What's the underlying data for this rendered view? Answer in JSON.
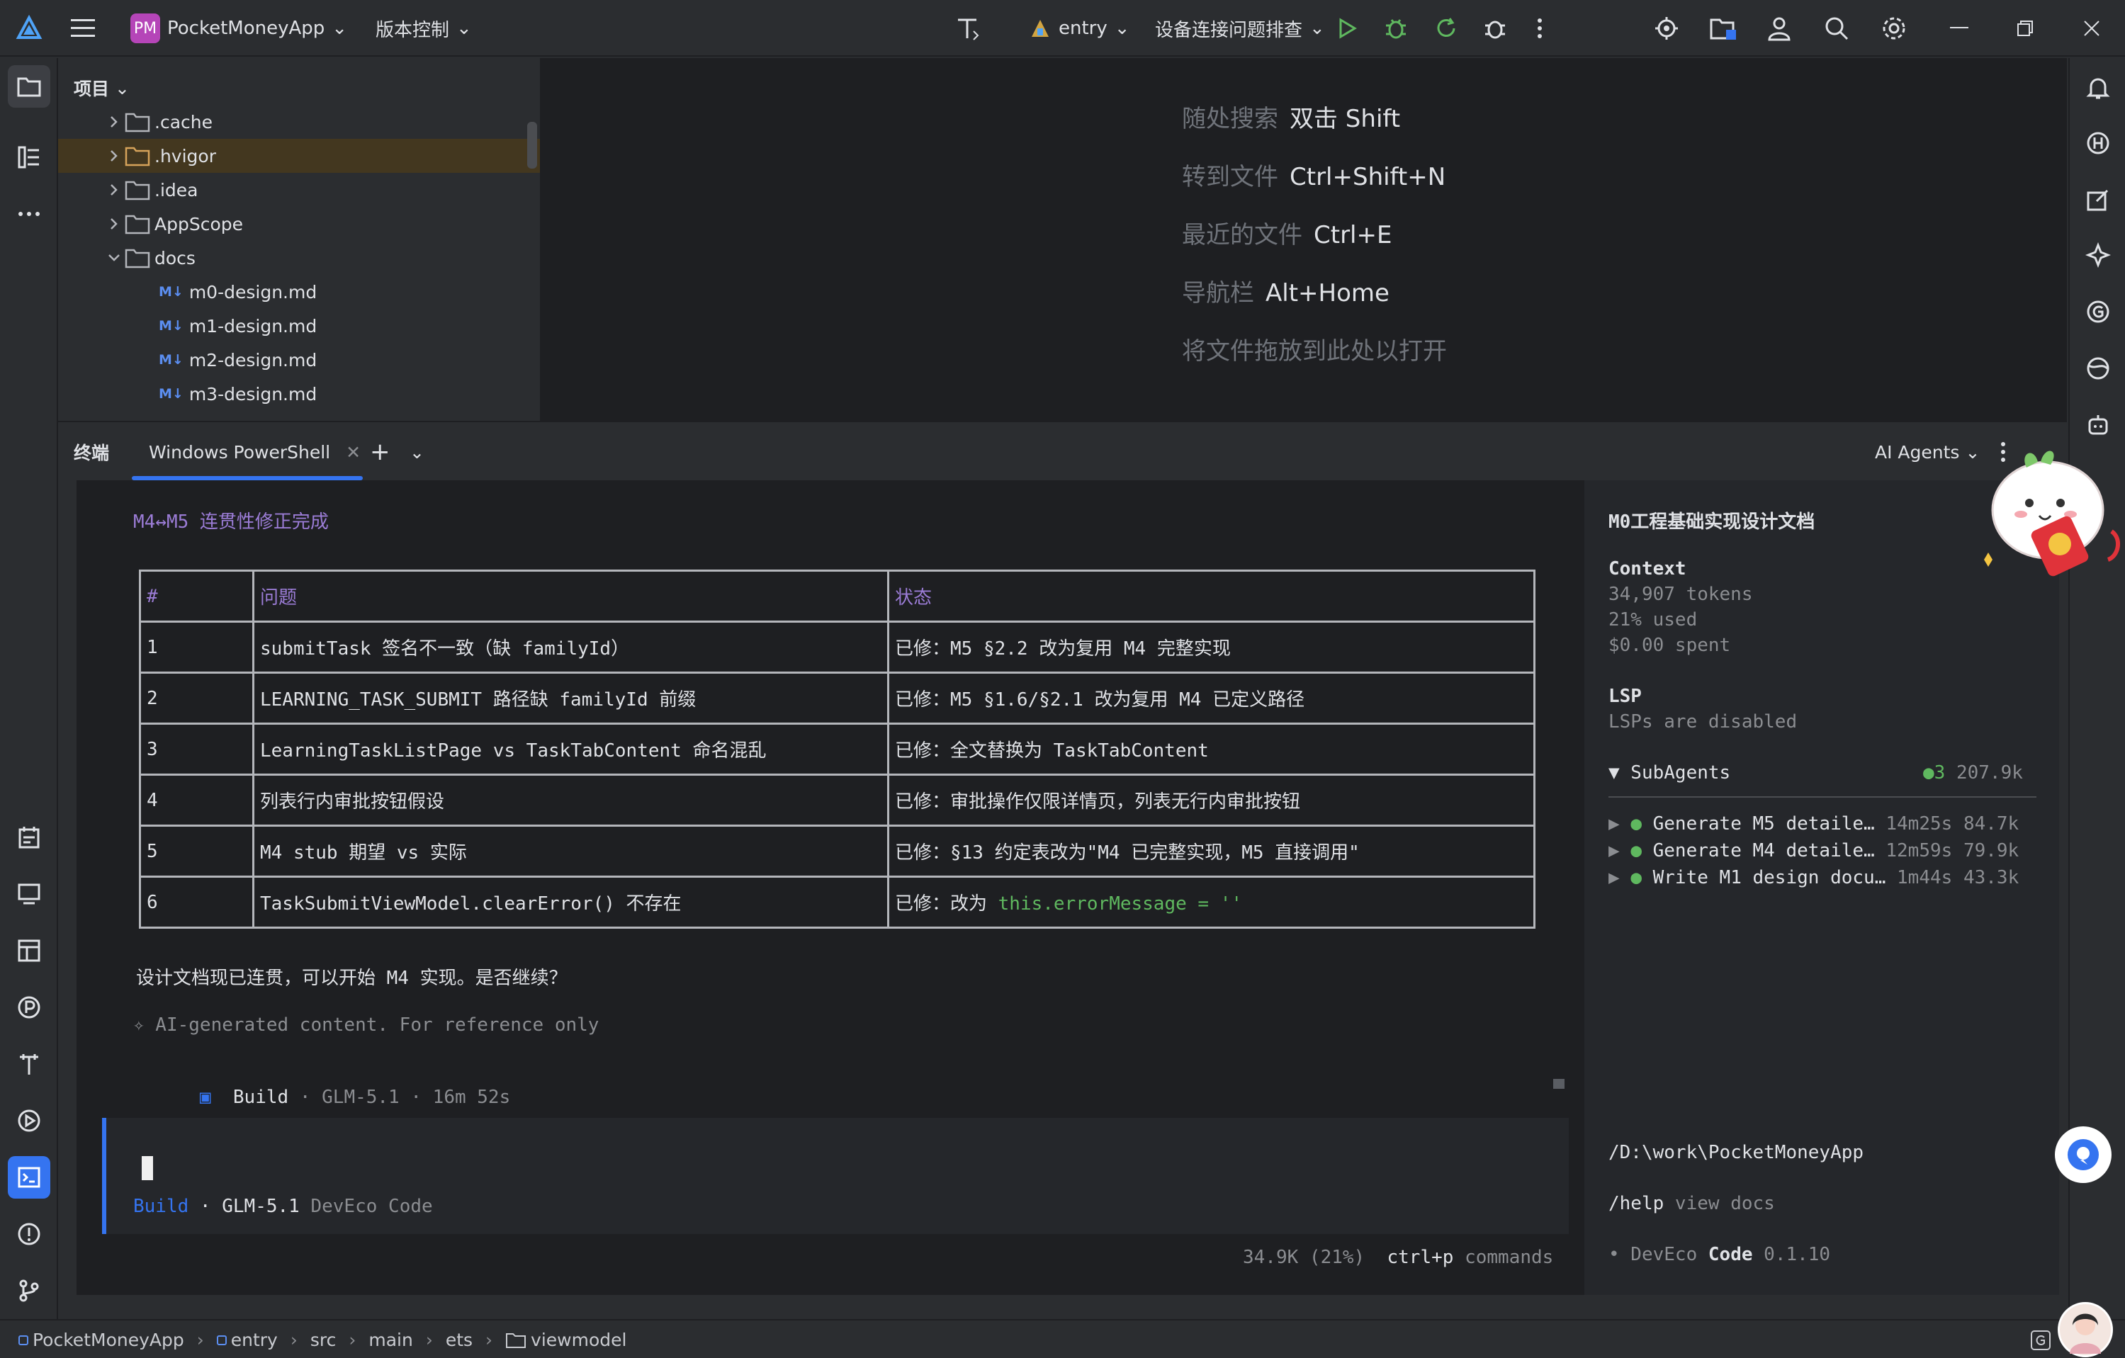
{
  "titlebar": {
    "project_name": "PocketMoneyApp",
    "project_badge": "PM",
    "vcs_label": "版本控制",
    "run_config": "entry",
    "device_label": "设备连接问题排查"
  },
  "project_panel": {
    "title": "项目",
    "items": [
      {
        "name": ".cache",
        "type": "folder",
        "expanded": false
      },
      {
        "name": ".hvigor",
        "type": "folder",
        "expanded": false,
        "selected": true
      },
      {
        "name": ".idea",
        "type": "folder",
        "expanded": false
      },
      {
        "name": "AppScope",
        "type": "folder",
        "expanded": false
      },
      {
        "name": "docs",
        "type": "folder",
        "expanded": true
      },
      {
        "name": "m0-design.md",
        "type": "md"
      },
      {
        "name": "m1-design.md",
        "type": "md"
      },
      {
        "name": "m2-design.md",
        "type": "md"
      },
      {
        "name": "m3-design.md",
        "type": "md"
      }
    ],
    "md_badge": "M↓"
  },
  "editor_hints": [
    {
      "label": "随处搜索",
      "key": "双击 Shift"
    },
    {
      "label": "转到文件",
      "key": "Ctrl+Shift+N"
    },
    {
      "label": "最近的文件",
      "key": "Ctrl+E"
    },
    {
      "label": "导航栏",
      "key": "Alt+Home"
    },
    {
      "label": "将文件拖放到此处以打开",
      "key": ""
    }
  ],
  "terminal_bar": {
    "title": "终端",
    "tab_label": "Windows PowerShell",
    "ai_agents_label": "AI Agents"
  },
  "terminal": {
    "heading": "M4↔M5 连贯性修正完成",
    "table_headers": [
      "#",
      "问题",
      "状态"
    ],
    "table_rows": [
      [
        "1",
        "submitTask 签名不一致（缺 familyId）",
        "已修：M5 §2.2 改为复用 M4 完整实现"
      ],
      [
        "2",
        "LEARNING_TASK_SUBMIT 路径缺 familyId 前缀",
        "已修：M5 §1.6/§2.1 改为复用 M4 已定义路径"
      ],
      [
        "3",
        "LearningTaskListPage vs TaskTabContent 命名混乱",
        "已修：全文替换为 TaskTabContent"
      ],
      [
        "4",
        "列表行内审批按钮假设",
        "已修：审批操作仅限详情页，列表无行内审批按钮"
      ],
      [
        "5",
        "M4 stub 期望 vs 实际",
        "已修：§13 约定表改为\"M4 已完整实现，M5 直接调用\""
      ],
      [
        "6",
        "TaskSubmitViewModel.clearError() 不存在",
        "已修：改为 "
      ]
    ],
    "row6_code": "this.errorMessage = ''",
    "summary": "设计文档现已连贯，可以开始 M4 实现。是否继续？",
    "ai_note": "✧ AI-generated content. For reference only",
    "build_icon": "▣",
    "build_label": "Build",
    "build_meta": " · GLM-5.1 · 16m 52s",
    "input_mode": "Build",
    "input_model": " · GLM-5.1 ",
    "input_app": "DevEco Code",
    "footer_usage": "34.9K (21%)",
    "footer_shortcut": "ctrl+p",
    "footer_commands": " commands"
  },
  "side_panel": {
    "doc_title": "M0工程基础实现设计文档",
    "context_label": "Context",
    "tokens": "34,907 tokens",
    "used": "21% used",
    "spent": "$0.00 spent",
    "lsp_label": "LSP",
    "lsp_status": "LSPs are disabled",
    "subagents_label": "▼ SubAgents",
    "subagents_count": "●3",
    "subagents_total": " 207.9k",
    "subagents": [
      {
        "name": "Generate M5 detaile…",
        "time": "14m25s",
        "tokens": "84.7k"
      },
      {
        "name": "Generate M4 detaile…",
        "time": "12m59s",
        "tokens": "79.9k"
      },
      {
        "name": "Write M1 design docu…",
        "time": "1m44s",
        "tokens": "43.3k"
      }
    ],
    "path": "/D:\\work\\PocketMoneyApp",
    "help_cmd": "/help",
    "help_text": " view docs",
    "version_prefix": "• DevEco ",
    "version_code": "Code",
    "version_num": " 0.1.10"
  },
  "statusbar": {
    "crumbs": [
      "PocketMoneyApp",
      "entry",
      "src",
      "main",
      "ets",
      "viewmodel"
    ]
  },
  "colors": {
    "accent": "#3574f0",
    "heading_purple": "#9b7cd6",
    "code_green": "#5fb85f",
    "selection": "#43371f"
  }
}
